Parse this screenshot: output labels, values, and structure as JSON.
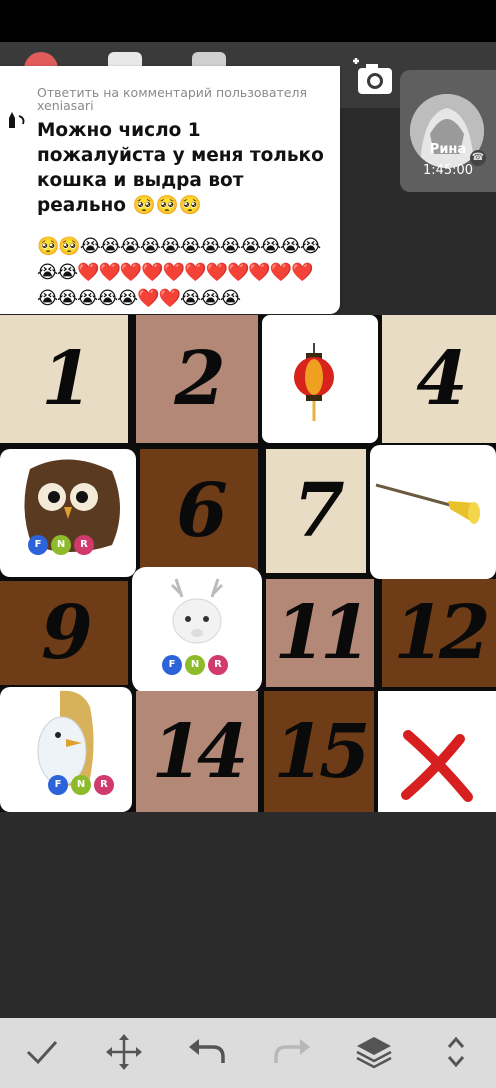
{
  "comment": {
    "reply_prefix": "Ответить на комментарий пользователя",
    "username": "xeniasari",
    "text": "Можно число 1 пожалуйста у меня только кошка и выдра вот реально 🥺🥺🥺",
    "emoji_tail": "🥺🥺😭😭😭😭😭😭😭😭😭😭😭😭😭😭❤️❤️❤️❤️❤️❤️❤️❤️❤️❤️❤️😭😭😭😭😭❤️❤️😭😭😭"
  },
  "call": {
    "name": "Рина",
    "duration": "1:45:00"
  },
  "grid": {
    "numbers": [
      "1",
      "2",
      "4",
      "6",
      "7",
      "9",
      "11",
      "12",
      "14",
      "15"
    ],
    "badge_labels": [
      "F",
      "N",
      "R"
    ]
  },
  "toolbar": {
    "icons": [
      "check-icon",
      "move-icon",
      "undo-icon",
      "redo-icon",
      "layers-icon",
      "expand-icon"
    ]
  }
}
